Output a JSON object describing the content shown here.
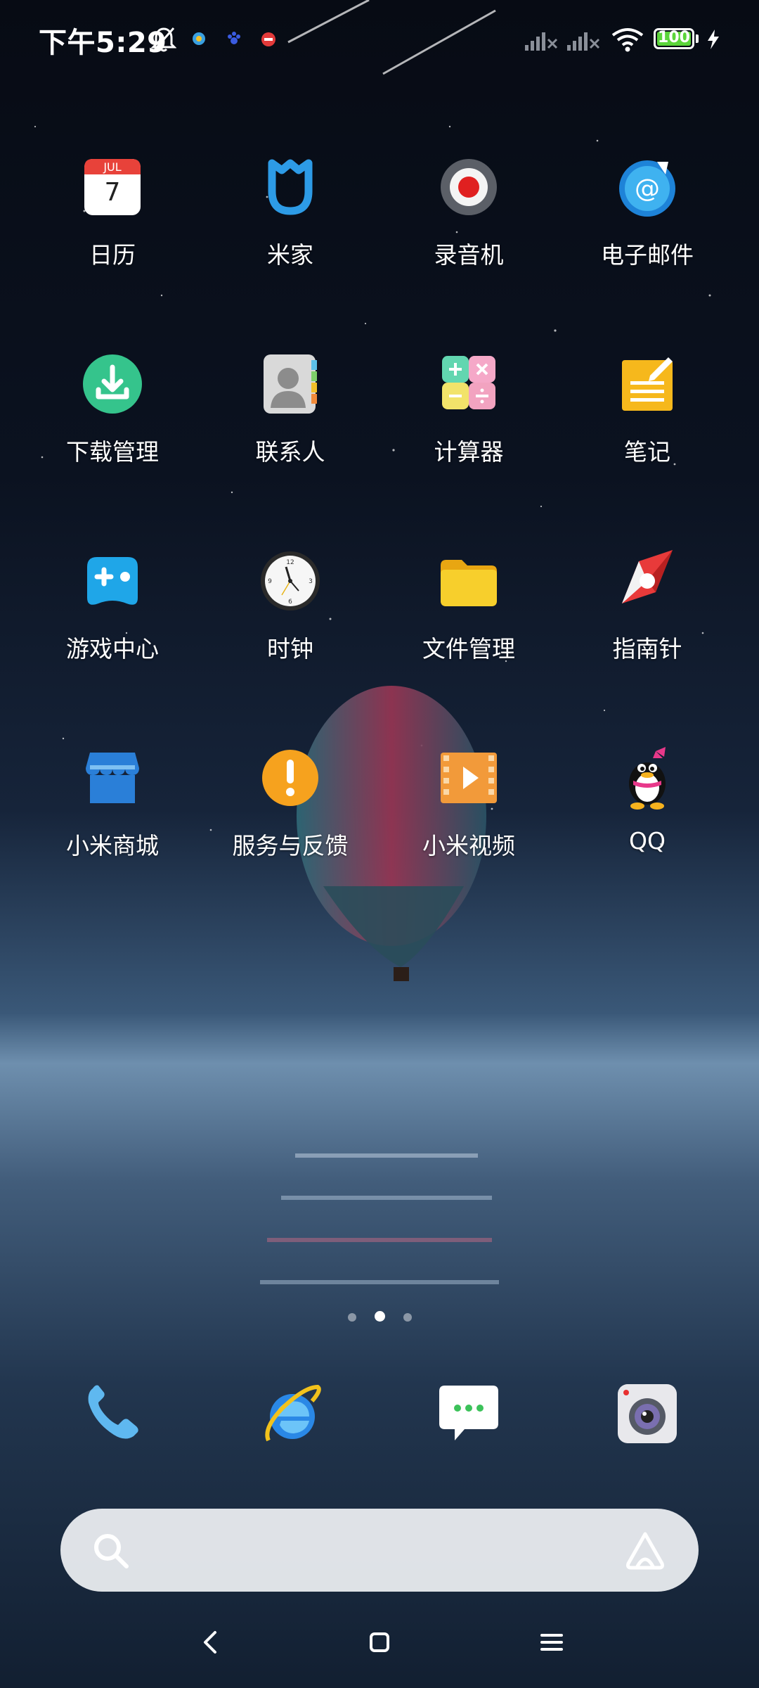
{
  "status_bar": {
    "time": "下午5:29",
    "battery_level": "100",
    "battery_color": "#5bd43a",
    "icons": [
      "bell-off-icon",
      "app-notify-icon",
      "baidu-paw-icon",
      "app-badge-icon",
      "signal-no-service-icon",
      "signal-no-service-icon",
      "wifi-icon",
      "charging-icon"
    ]
  },
  "apps": [
    {
      "label": "日历",
      "icon": "calendar-icon",
      "month": "JUL",
      "day": "7"
    },
    {
      "label": "米家",
      "icon": "mijia-icon"
    },
    {
      "label": "录音机",
      "icon": "recorder-icon"
    },
    {
      "label": "电子邮件",
      "icon": "email-icon"
    },
    {
      "label": "下载管理",
      "icon": "download-icon"
    },
    {
      "label": "联系人",
      "icon": "contacts-icon"
    },
    {
      "label": "计算器",
      "icon": "calculator-icon"
    },
    {
      "label": "笔记",
      "icon": "notes-icon"
    },
    {
      "label": "游戏中心",
      "icon": "gamepad-icon"
    },
    {
      "label": "时钟",
      "icon": "clock-icon"
    },
    {
      "label": "文件管理",
      "icon": "folder-icon"
    },
    {
      "label": "指南针",
      "icon": "compass-icon"
    },
    {
      "label": "小米商城",
      "icon": "store-icon"
    },
    {
      "label": "服务与反馈",
      "icon": "feedback-icon"
    },
    {
      "label": "小米视频",
      "icon": "video-icon"
    },
    {
      "label": "QQ",
      "icon": "qq-penguin-icon"
    }
  ],
  "page_indicator": {
    "count": 3,
    "active": 1
  },
  "dock": [
    "phone-icon",
    "browser-icon",
    "messages-icon",
    "camera-icon"
  ],
  "search_bar": {
    "placeholder": "",
    "icon": "search-icon",
    "assistant_icon": "xiaoai-icon"
  },
  "nav_bar": [
    "back-icon",
    "home-icon",
    "menu-icon"
  ]
}
